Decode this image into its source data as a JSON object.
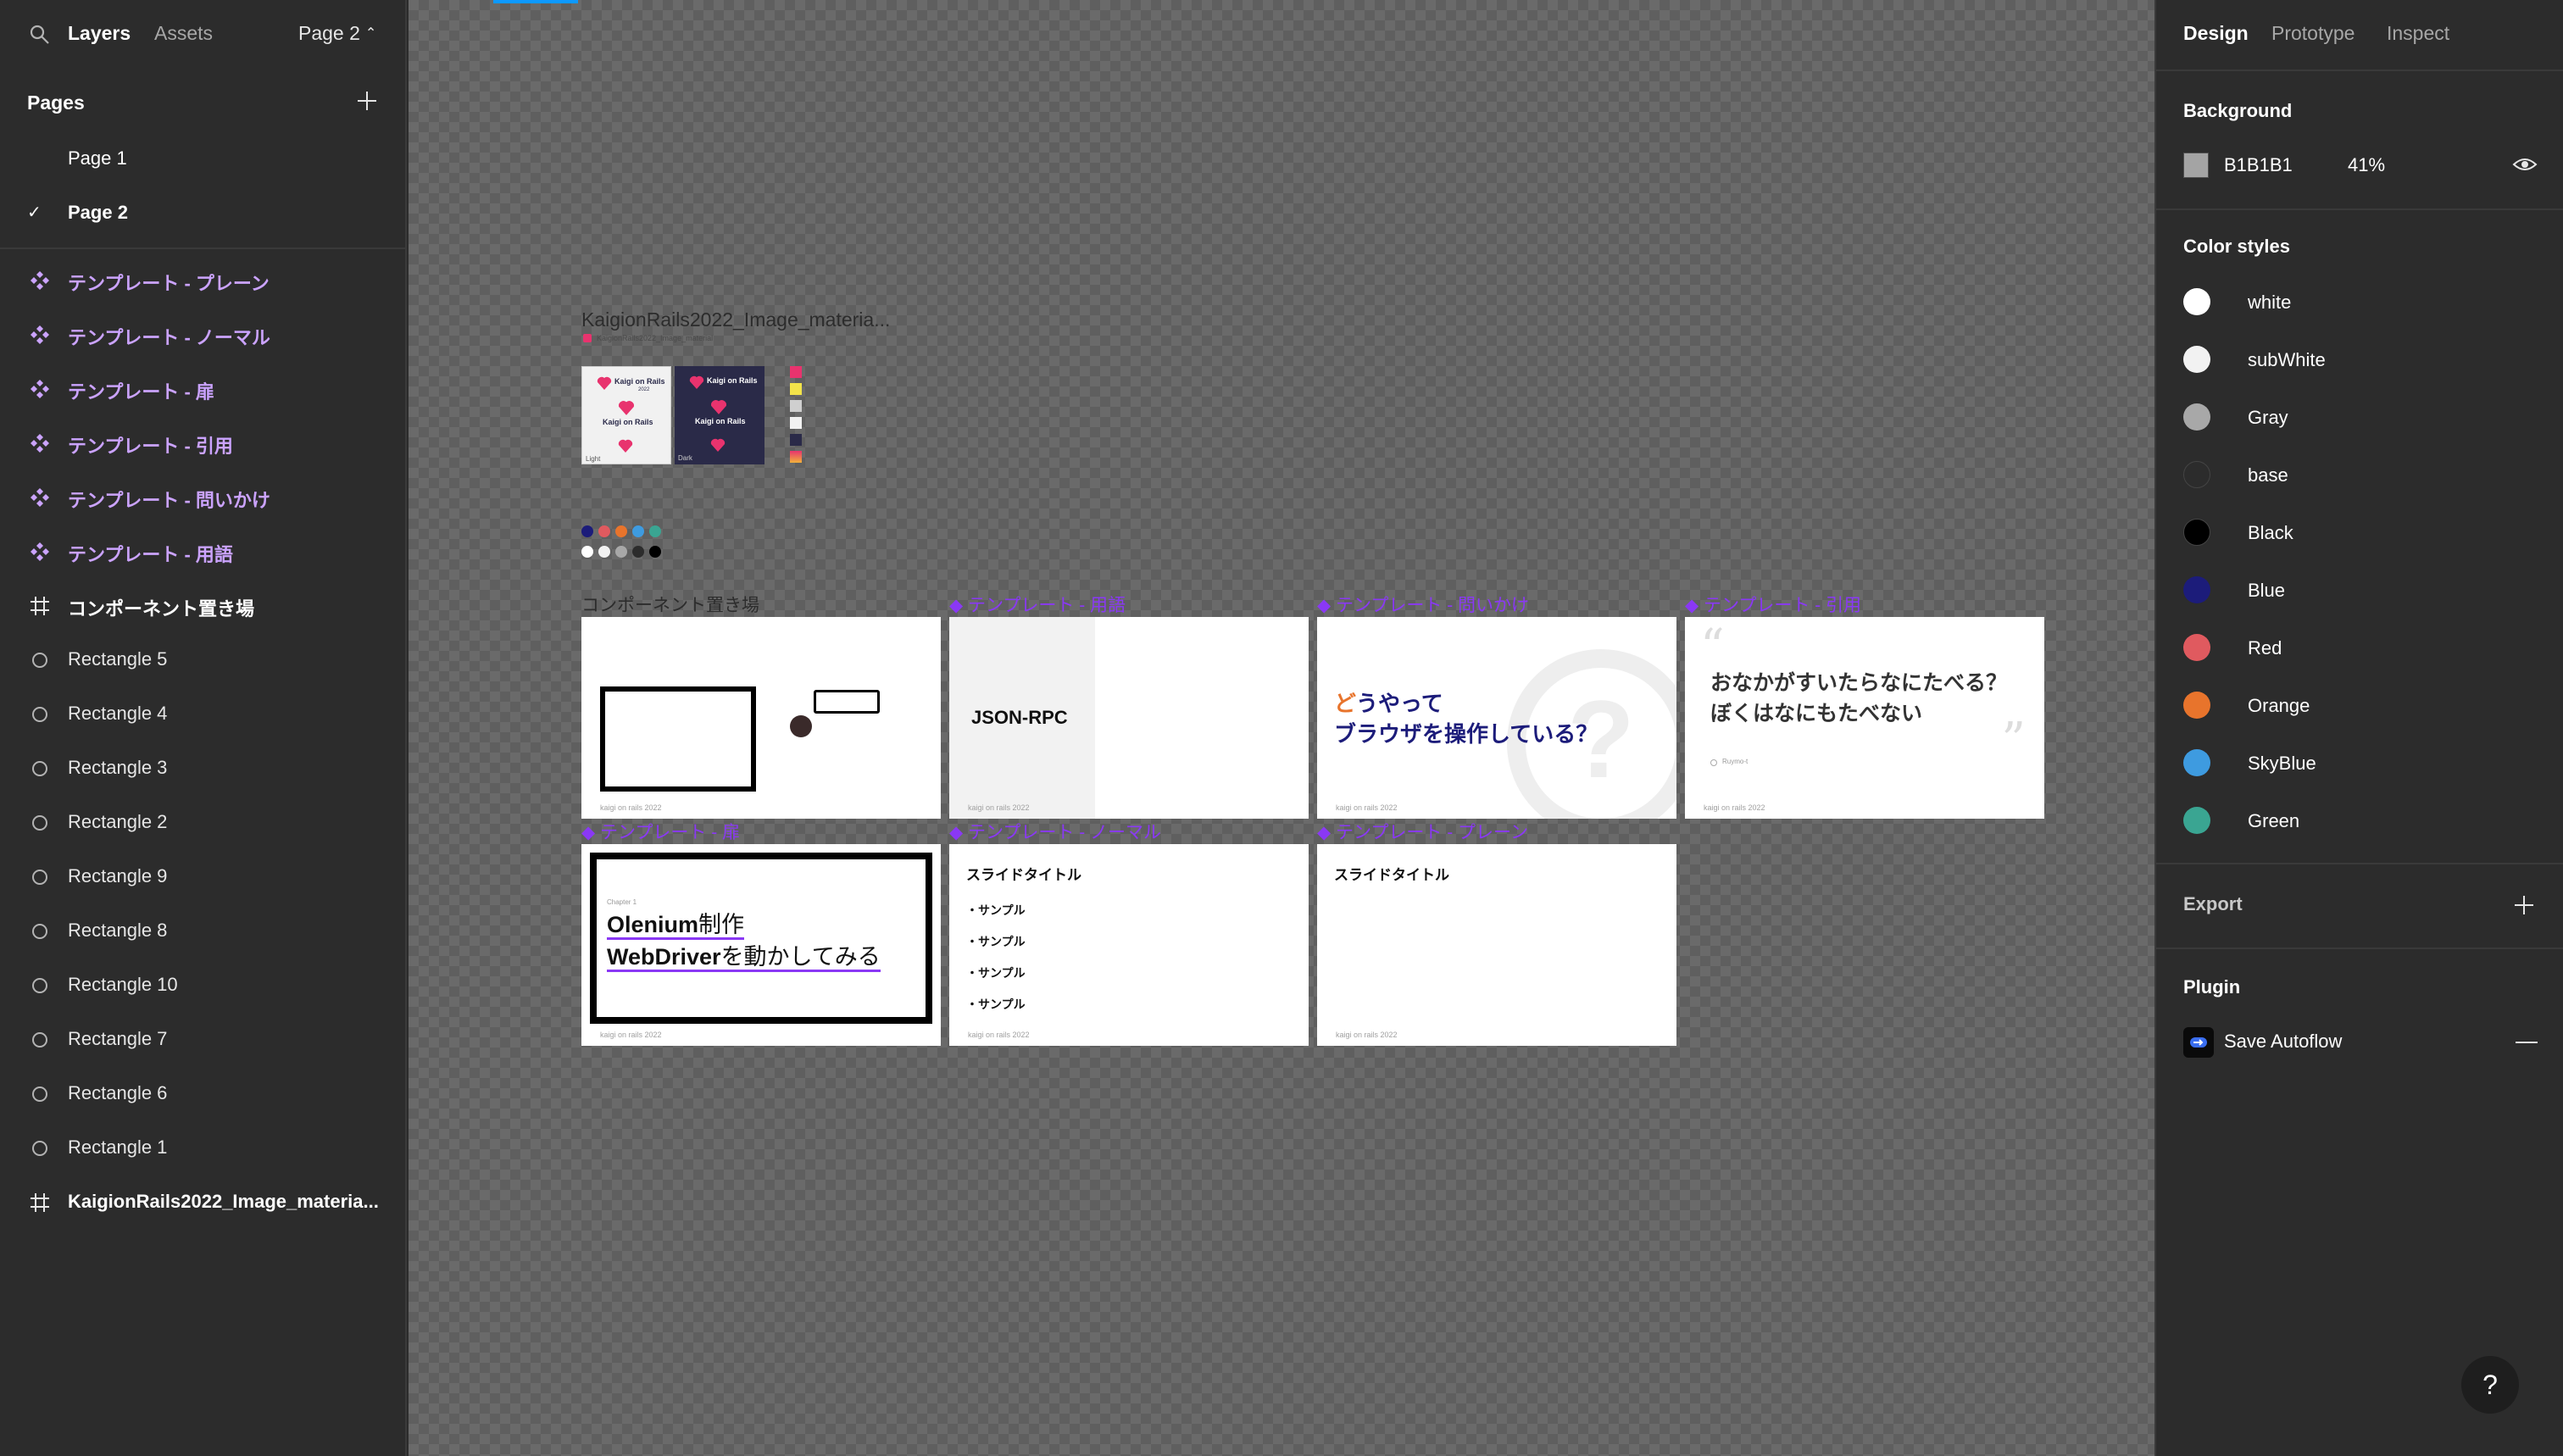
{
  "left_panel": {
    "tabs": {
      "layers": "Layers",
      "assets": "Assets"
    },
    "page_select": "Page 2",
    "pages_title": "Pages",
    "pages": [
      {
        "label": "Page 1",
        "active": false
      },
      {
        "label": "Page 2",
        "active": true
      }
    ],
    "layers": [
      {
        "label": "テンプレート - プレーン",
        "type": "component"
      },
      {
        "label": "テンプレート - ノーマル",
        "type": "component"
      },
      {
        "label": "テンプレート - 扉",
        "type": "component"
      },
      {
        "label": "テンプレート - 引用",
        "type": "component"
      },
      {
        "label": "テンプレート - 問いかけ",
        "type": "component"
      },
      {
        "label": "テンプレート - 用語",
        "type": "component"
      },
      {
        "label": "コンポーネント置き場",
        "type": "frame"
      },
      {
        "label": "Rectangle 5",
        "type": "rect"
      },
      {
        "label": "Rectangle 4",
        "type": "rect"
      },
      {
        "label": "Rectangle 3",
        "type": "rect"
      },
      {
        "label": "Rectangle 2",
        "type": "rect"
      },
      {
        "label": "Rectangle 9",
        "type": "rect"
      },
      {
        "label": "Rectangle 8",
        "type": "rect"
      },
      {
        "label": "Rectangle 10",
        "type": "rect"
      },
      {
        "label": "Rectangle 7",
        "type": "rect"
      },
      {
        "label": "Rectangle 6",
        "type": "rect"
      },
      {
        "label": "Rectangle 1",
        "type": "rect"
      },
      {
        "label": "KaigionRails2022_Image_materia...",
        "type": "frame"
      }
    ]
  },
  "canvas": {
    "image_frame_label": "KaigionRails2022_Image_materia...",
    "image_sub_label": "KaigionRails2022_Image_material",
    "logo_cards": [
      {
        "title": "Kaigi on Rails",
        "year": "2022",
        "caption": "Light"
      },
      {
        "title": "Kaigi on Rails",
        "year": "2022",
        "caption": "Dark"
      }
    ],
    "component_frame_label": "コンポーネント置き場",
    "template_labels": [
      "テンプレート - 用語",
      "テンプレート - 問いかけ",
      "テンプレート - 引用",
      "テンプレート - 扉",
      "テンプレート - ノーマル",
      "テンプレート - プレーン"
    ],
    "slides": {
      "footer": "kaigi on rails 2022",
      "term": "JSON-RPC",
      "question_first": "ど",
      "question_line1_rest": "うやって",
      "question_line2": "ブラウザを操作している？",
      "quote_line1": "おなかがすいたらなにたべる？",
      "quote_line2": "ぼくはなにもたべない",
      "quote_author": "Ruymo-t",
      "chapter": "Chapter 1",
      "door_line1_a": "Olenium",
      "door_line1_b": "制作",
      "door_line2_a": "WebDriver",
      "door_line2_b": "を動かしてみる",
      "normal_title": "スライドタイトル",
      "normal_items": [
        "・サンプル",
        "・サンプル",
        "・サンプル",
        "・サンプル"
      ],
      "plain_title": "スライドタイトル"
    }
  },
  "right_panel": {
    "tabs": {
      "design": "Design",
      "prototype": "Prototype",
      "inspect": "Inspect"
    },
    "background_title": "Background",
    "background_hex": "B1B1B1",
    "background_opacity": "41%",
    "color_styles_title": "Color styles",
    "color_styles": [
      {
        "name": "white",
        "color": "#ffffff"
      },
      {
        "name": "subWhite",
        "color": "#f2f2f2"
      },
      {
        "name": "Gray",
        "color": "#a8a8a8"
      },
      {
        "name": "base",
        "color": "#2c2c2c"
      },
      {
        "name": "Black",
        "color": "#000000"
      },
      {
        "name": "Blue",
        "color": "#1c1c7a"
      },
      {
        "name": "Red",
        "color": "#e05a5f"
      },
      {
        "name": "Orange",
        "color": "#e8742c"
      },
      {
        "name": "SkyBlue",
        "color": "#3e9be0"
      },
      {
        "name": "Green",
        "color": "#3aa592"
      }
    ],
    "export_title": "Export",
    "plugin_title": "Plugin",
    "plugin_name": "Save Autoflow"
  },
  "help_label": "?"
}
